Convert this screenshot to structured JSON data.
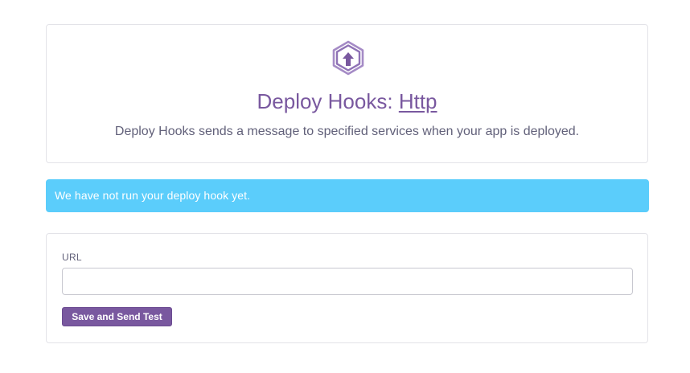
{
  "header": {
    "icon": "deploy-hook-upload-icon",
    "title_prefix": "Deploy Hooks: ",
    "title_link": "Http",
    "description": "Deploy Hooks sends a message to specified services when your app is deployed."
  },
  "alert": {
    "message": "We have not run your deploy hook yet.",
    "color": "#5bcdfb"
  },
  "form": {
    "url_label": "URL",
    "url_value": "",
    "url_placeholder": "",
    "submit_label": "Save and Send Test"
  },
  "colors": {
    "accent": "#79589f",
    "text": "#62617a"
  }
}
